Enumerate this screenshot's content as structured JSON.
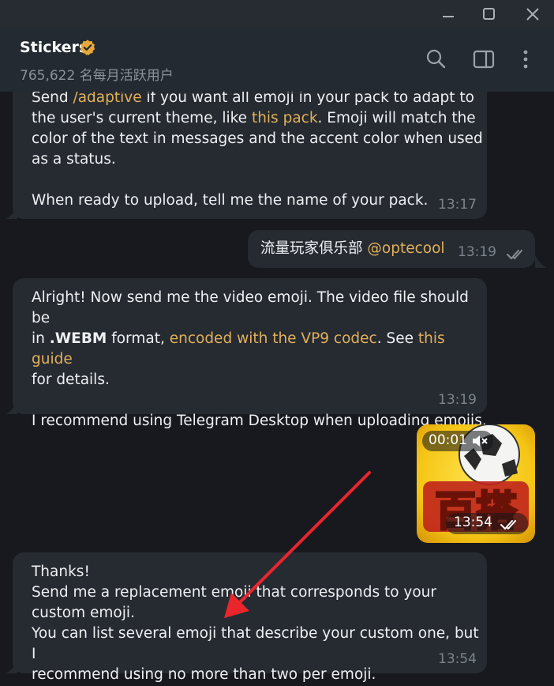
{
  "window": {
    "minimize_icon": "minimize-icon",
    "maximize_icon": "maximize-icon",
    "close_icon": "close-icon"
  },
  "header": {
    "title": "Stickers",
    "subtitle": "765,622 名每月活跃用户",
    "icons": [
      "verified-badge-icon",
      "search-icon",
      "sidebar-toggle-icon",
      "more-vertical-icon"
    ]
  },
  "messages": [
    {
      "side": "in",
      "lines": [
        {
          "pre": "Send ",
          "link": "/adaptive",
          "post": " if you want all emoji in your pack to adapt to"
        },
        {
          "pre": "the user's current theme, like ",
          "link": "this pack",
          "post": ". Emoji will match the"
        },
        {
          "pre": "color of the text in messages and the accent color when used"
        },
        {
          "pre": "as a status."
        },
        {
          "pre": ""
        },
        {
          "pre": "When ready to upload, tell me the name of your pack."
        }
      ],
      "time": "13:17"
    },
    {
      "side": "out",
      "text": "流量玩家俱乐部",
      "mention": "@optecool",
      "time": "13:19",
      "status_icon": "double-check-icon"
    },
    {
      "side": "in",
      "lines": [
        {
          "pre": "Alright! Now send me the video emoji. The video file should be"
        },
        {
          "pre": "in ",
          "bold": ".WEBM",
          "post": " format, ",
          "link": "encoded with the VP9 codec",
          "post2": ". See ",
          "link2": "this guide"
        },
        {
          "pre": "for details."
        },
        {
          "pre": ""
        },
        {
          "pre": "I recommend using Telegram Desktop when uploading emojis."
        }
      ],
      "time": "13:19"
    },
    {
      "side": "out",
      "type": "video",
      "duration": "00:01",
      "mute_icon": "muted-speaker-icon",
      "time": "13:54",
      "status_icon": "double-check-icon",
      "thumbnail_text": "百搭"
    },
    {
      "side": "in",
      "lines": [
        {
          "pre": "Thanks!"
        },
        {
          "pre": "Send me a replacement emoji that corresponds to your"
        },
        {
          "pre": "custom emoji."
        },
        {
          "pre": "You can list several emoji that describe your custom one, but I"
        },
        {
          "pre": "recommend using no more than two per emoji."
        }
      ],
      "time": "13:54"
    }
  ],
  "colors": {
    "background": "#17191f",
    "bubble": "#262b32",
    "link": "#e2b05a",
    "verified": "#e8a93a",
    "annotation_arrow": "#e8262c"
  }
}
